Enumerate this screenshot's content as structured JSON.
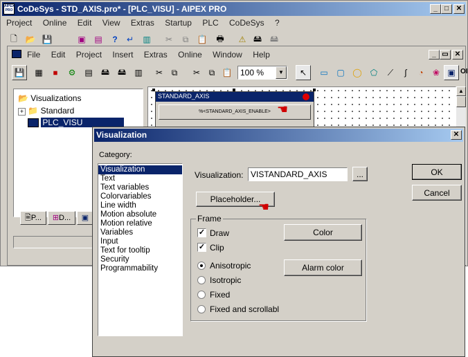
{
  "main_window": {
    "title": "CoDeSys - STD_AXIS.pro* - [PLC_VISU] - AIPEX PRO",
    "app_icon_text": "AIPEX PRO",
    "menu": [
      "Project",
      "Online",
      "Edit",
      "View",
      "Extras",
      "Startup",
      "PLC",
      "CoDeSys",
      "?"
    ]
  },
  "child_window": {
    "menu": [
      "File",
      "Edit",
      "Project",
      "Insert",
      "Extras",
      "Online",
      "Window",
      "Help"
    ],
    "zoom": "100 %",
    "last_toolbar_label": "OI"
  },
  "tree": {
    "root": "Visualizations",
    "items": [
      "Standard",
      "PLC_VISU"
    ],
    "tabs": [
      "P...",
      "D..."
    ]
  },
  "canvas": {
    "element_title": "STANDARD_AXIS",
    "element_button": "%<STANDARD_AXIS_ENABLE>"
  },
  "dialog": {
    "title": "Visualization",
    "category_label": "Category:",
    "categories": [
      "Visualization",
      "Text",
      "Text variables",
      "Colorvariables",
      "Line width",
      "Motion absolute",
      "Motion relative",
      "Variables",
      "Input",
      "Text for tooltip",
      "Security",
      "Programmability"
    ],
    "selected_category": "Visualization",
    "visualization_label": "Visualization:",
    "visualization_value": "VISTANDARD_AXIS",
    "browse_label": "...",
    "placeholder_button": "Placeholder...",
    "ok_button": "OK",
    "cancel_button": "Cancel",
    "frame_label": "Frame",
    "draw_label": "Draw",
    "draw_checked": true,
    "clip_label": "Clip",
    "clip_checked": true,
    "color_button": "Color",
    "alarm_color_button": "Alarm color",
    "scale_options": [
      "Anisotropic",
      "Isotropic",
      "Fixed",
      "Fixed and scrollabl"
    ],
    "selected_scale": "Anisotropic"
  },
  "colors": {
    "title_active": "#0a246a",
    "window_bg": "#d4d0c8",
    "selection": "#0a246a",
    "alarm_dot": "#e00000"
  }
}
